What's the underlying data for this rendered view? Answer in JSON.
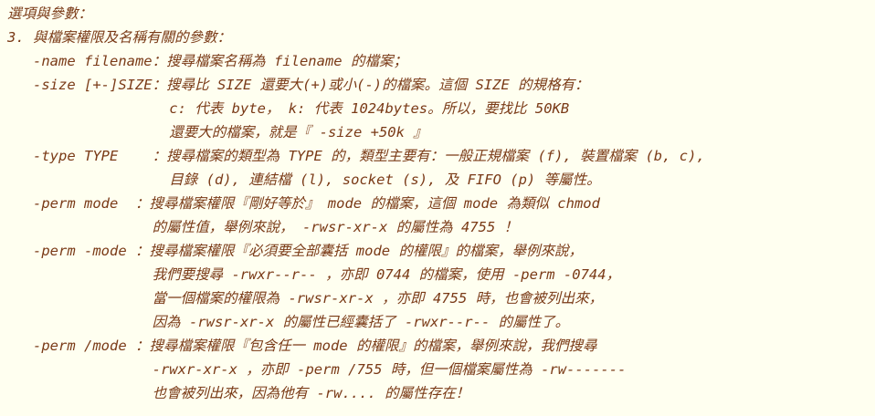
{
  "lines": [
    "選項與參數：",
    "3. 與檔案權限及名稱有關的參數：",
    "   -name filename：搜尋檔案名稱為 filename 的檔案；",
    "   -size [+-]SIZE：搜尋比 SIZE 還要大(+)或小(-)的檔案。這個 SIZE 的規格有：",
    "                   c: 代表 byte， k: 代表 1024bytes。所以，要找比 50KB",
    "                   還要大的檔案，就是『 -size +50k 』",
    "   -type TYPE    ：搜尋檔案的類型為 TYPE 的，類型主要有：一般正規檔案 (f), 裝置檔案 (b, c),",
    "                   目錄 (d), 連結檔 (l), socket (s), 及 FIFO (p) 等屬性。",
    "   -perm mode  ：搜尋檔案權限『剛好等於』 mode 的檔案，這個 mode 為類似 chmod",
    "                 的屬性值，舉例來說， -rwsr-xr-x 的屬性為 4755 ！",
    "   -perm -mode ：搜尋檔案權限『必須要全部囊括 mode 的權限』的檔案，舉例來說，",
    "                 我們要搜尋 -rwxr--r-- ，亦即 0744 的檔案，使用 -perm -0744，",
    "                 當一個檔案的權限為 -rwsr-xr-x ，亦即 4755 時，也會被列出來，",
    "                 因為 -rwsr-xr-x 的屬性已經囊括了 -rwxr--r-- 的屬性了。",
    "   -perm /mode ：搜尋檔案權限『包含任一 mode 的權限』的檔案，舉例來說，我們搜尋",
    "                 -rwxr-xr-x ，亦即 -perm /755 時，但一個檔案屬性為 -rw-------",
    "                 也會被列出來，因為他有 -rw.... 的屬性存在！"
  ],
  "colors": {
    "background": "#fffff0",
    "text": "#7a3a17"
  }
}
